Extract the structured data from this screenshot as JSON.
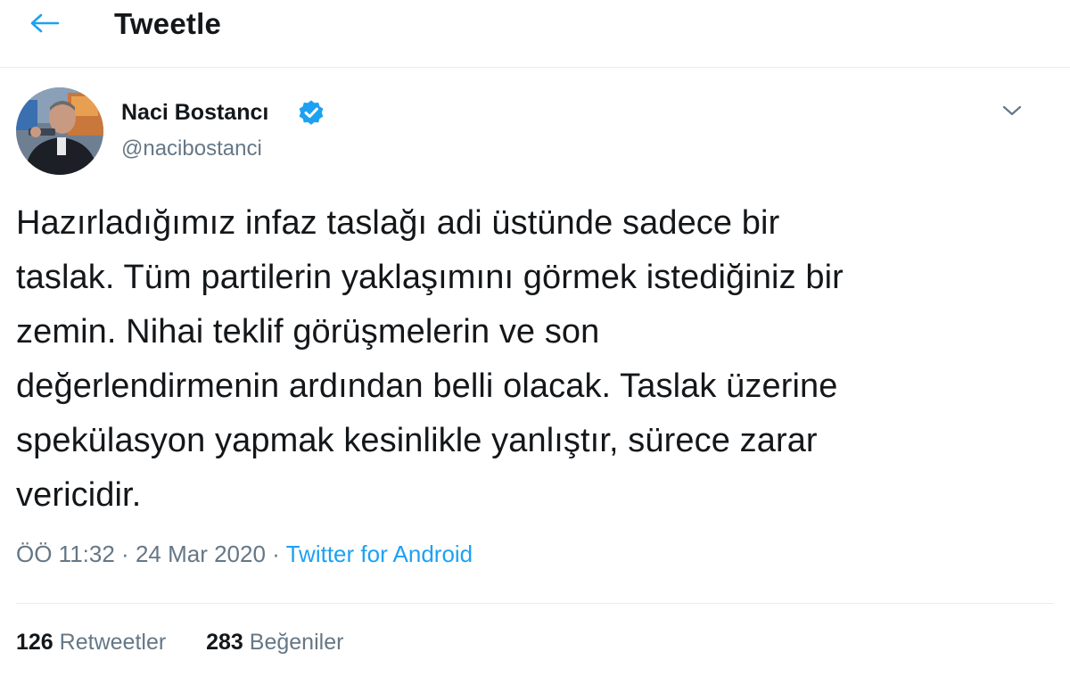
{
  "header": {
    "title": "Tweetle",
    "back_icon": "back-arrow-icon"
  },
  "author": {
    "name": "Naci Bostancı",
    "handle": "@nacibostanci",
    "verified_icon": "verified-badge-icon",
    "menu_icon": "chevron-down-icon"
  },
  "tweet": {
    "lines": [
      "Hazırladığımız infaz taslağı adi üstünde sadece bir",
      "taslak. Tüm partilerin yaklaşımını görmek istediğiniz bir",
      "zemin. Nihai teklif görüşmelerin ve son",
      "değerlendirmenin ardından belli olacak. Taslak üzerine",
      "spekülasyon yapmak kesinlikle yanlıştır, sürece zarar",
      "vericidir."
    ]
  },
  "meta": {
    "time": "ÖÖ 11:32",
    "separator": "·",
    "date": "24 Mar 2020",
    "source": "Twitter for Android"
  },
  "stats": {
    "retweets_count": "126",
    "retweets_label": "Retweetler",
    "likes_count": "283",
    "likes_label": "Beğeniler"
  },
  "colors": {
    "accent": "#1da1f2",
    "secondary_text": "#657786",
    "primary_text": "#14171a"
  }
}
